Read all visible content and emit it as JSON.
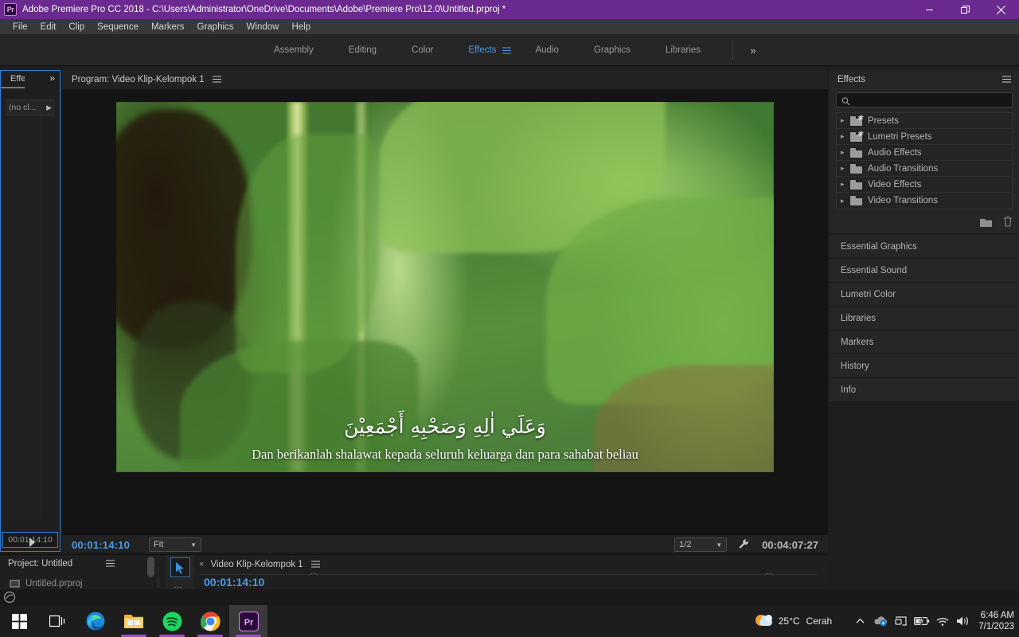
{
  "titlebar": {
    "app_badge": "Pr",
    "title": "Adobe Premiere Pro CC 2018 - C:\\Users\\Administrator\\OneDrive\\Documents\\Adobe\\Premiere Pro\\12.0\\Untitled.prproj *",
    "minimize": "—",
    "restore": "❐",
    "close": "✕",
    "accent_color": "#6b2a8f"
  },
  "menubar": {
    "items": [
      "File",
      "Edit",
      "Clip",
      "Sequence",
      "Markers",
      "Graphics",
      "Window",
      "Help"
    ]
  },
  "workspaces": {
    "tabs": [
      {
        "label": "Assembly",
        "active": false
      },
      {
        "label": "Editing",
        "active": false
      },
      {
        "label": "Color",
        "active": false
      },
      {
        "label": "Effects",
        "active": true
      },
      {
        "label": "Audio",
        "active": false
      },
      {
        "label": "Graphics",
        "active": false
      },
      {
        "label": "Libraries",
        "active": false
      }
    ],
    "overflow": "»",
    "active_color": "#4a9ae8"
  },
  "effect_controls_panel": {
    "tab_label": "Effec",
    "overflow": "»",
    "clip_row": "(no cl...",
    "expand_arrow": "▶",
    "timecode": "00:01:14:10"
  },
  "program_monitor": {
    "title": "Program: Video Klip-Kelompok 1",
    "burger": "≡",
    "current_timecode": "00:01:14:10",
    "fit_value": "Fit",
    "resolution_value": "1/2",
    "duration_timecode": "00:04:07:27",
    "wrench": "settings-wrench",
    "plus": "+",
    "subtitle_arabic": "وَعَلَي اٰلِهِ وَصَحْبِهِ أَجْمَعِيْنَ",
    "subtitle_latin": "Dan berikanlah shalawat kepada seluruh keluarga dan para sahabat beliau",
    "transport_buttons": [
      "add-marker",
      "mark-in",
      "mark-out",
      "go-to-in",
      "step-back",
      "play-stop",
      "step-forward",
      "go-to-out",
      "lift",
      "extract",
      "export-frame"
    ]
  },
  "effects_panel": {
    "title": "Effects",
    "burger": "≡",
    "search_value": "",
    "search_placeholder": "",
    "items": [
      {
        "label": "Presets",
        "starred": true
      },
      {
        "label": "Lumetri Presets",
        "starred": true
      },
      {
        "label": "Audio Effects",
        "starred": false
      },
      {
        "label": "Audio Transitions",
        "starred": false
      },
      {
        "label": "Video Effects",
        "starred": false
      },
      {
        "label": "Video Transitions",
        "starred": false
      }
    ],
    "footer_icons": [
      "new-custom-bin",
      "delete-custom-item"
    ]
  },
  "right_panels": {
    "items": [
      "Essential Graphics",
      "Essential Sound",
      "Lumetri Color",
      "Libraries",
      "Markers",
      "History",
      "Info"
    ]
  },
  "project_panel": {
    "title": "Project: Untitled",
    "burger": "≡",
    "file_name": "Untitled.prproj"
  },
  "timeline_panel": {
    "close": "×",
    "sequence_name": "Video Klip-Kelompok 1",
    "burger": "≡",
    "timecode": "00:01:14:10",
    "tool": "selection-tool"
  },
  "taskbar": {
    "apps": [
      {
        "name": "start-button",
        "label": "Start"
      },
      {
        "name": "task-view-button",
        "label": "Task View"
      },
      {
        "name": "microsoft-edge",
        "label": "Microsoft Edge"
      },
      {
        "name": "file-explorer",
        "label": "File Explorer"
      },
      {
        "name": "spotify",
        "label": "Spotify"
      },
      {
        "name": "google-chrome",
        "label": "Google Chrome"
      },
      {
        "name": "adobe-premiere-pro",
        "label": "Adobe Premiere Pro"
      }
    ],
    "weather_temp": "25°C",
    "weather_condition": "Cerah",
    "tray_chevron": "∧",
    "time": "6:46 AM",
    "date": "7/1/2023"
  }
}
